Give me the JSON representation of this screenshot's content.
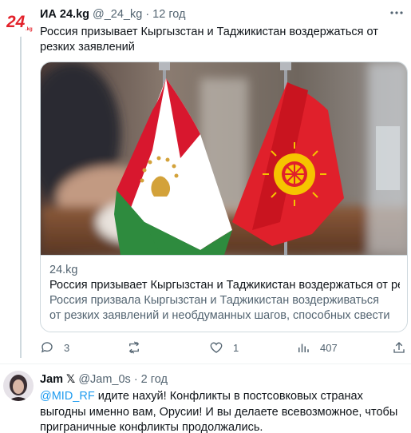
{
  "tweet": {
    "author_name": "ИА 24.kg",
    "author_handle": "@_24_kg",
    "separator": "·",
    "time": "12 год",
    "text": "Россия призывает Кыргызстан и Таджикистан воздержаться от резких заявлений",
    "card": {
      "domain": "24.kg",
      "title": "Россия призывает Кыргызстан и Таджикистан воздержаться от рез...",
      "description_line1": "Россия призвала Кыргызстан и Таджикистан воздерживаться",
      "description_line2": "от резких заявлений и необдуманных шагов, способных свести ..."
    },
    "actions": {
      "reply_count": "3",
      "retweet_count": "",
      "like_count": "1",
      "views_count": "407"
    }
  },
  "reply": {
    "author_name": "Jam",
    "author_badge": "𝕏",
    "author_handle": "@Jam_0s",
    "separator": "·",
    "time": "2 год",
    "mention": "@MID_RF",
    "text": " идите нахуй! Конфликты в постсовковых странах выгодны именно вам, Орусии! И вы делаете всевозможное, чтобы приграничные конфликты продолжались."
  },
  "colors": {
    "text": "#0f1419",
    "secondary": "#536471",
    "link": "#1d9bf0",
    "border": "#cfd9de",
    "logo_red": "#e3222b"
  }
}
